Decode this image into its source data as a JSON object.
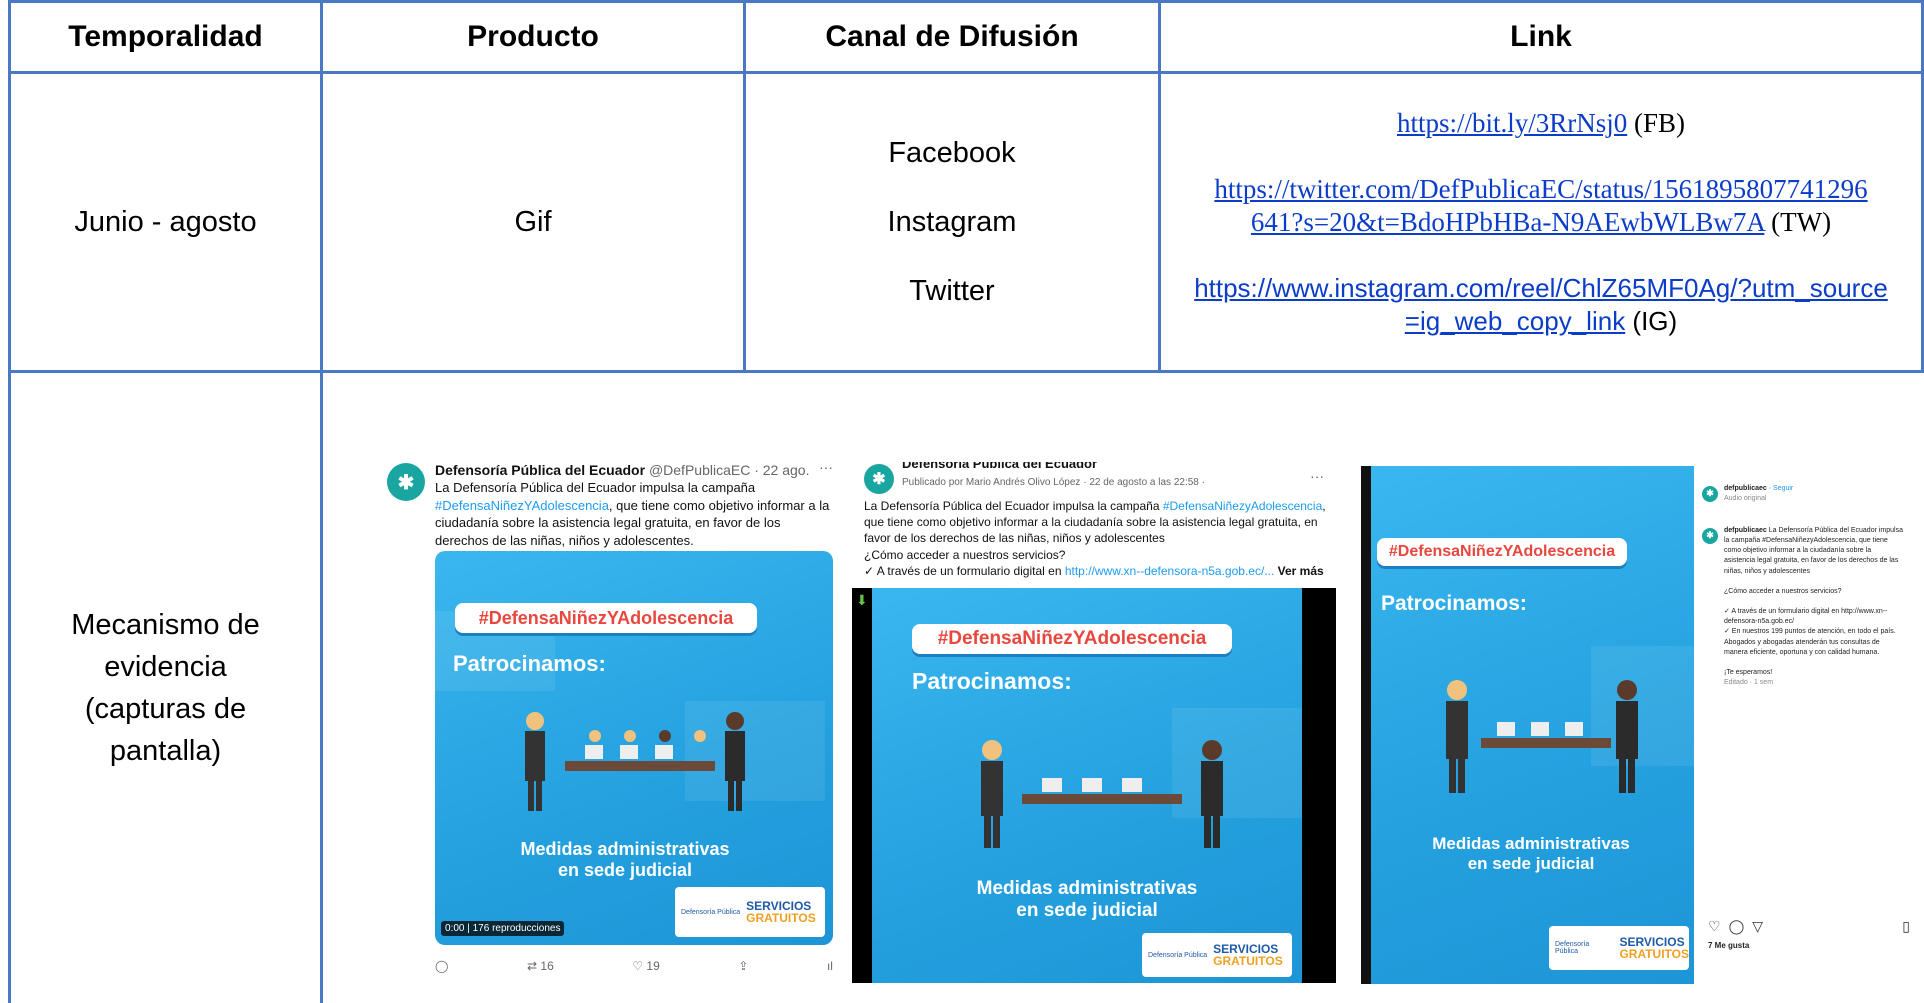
{
  "table": {
    "headers": {
      "temporalidad": "Temporalidad",
      "producto": "Producto",
      "canal": "Canal de Difusión",
      "link": "Link"
    },
    "row1": {
      "temporalidad": "Junio - agosto",
      "producto": "Gif",
      "canales": [
        "Facebook",
        "Instagram",
        "Twitter"
      ],
      "links": [
        {
          "url": "https://bit.ly/3RrNsj0",
          "tag": " (FB)"
        },
        {
          "url_line1": "https://twitter.com/DefPublicaEC/status/1561895807741296",
          "url_line2": "641?s=20&t=BdoHPbHBa-N9AEwbWLBw7A",
          "tag": " (TW)"
        },
        {
          "url_line1": "https://www.instagram.com/reel/ChlZ65MF0Ag/?utm_source",
          "url_line2": "=ig_web_copy_link",
          "tag": " (IG)"
        }
      ]
    },
    "row2": {
      "label_lines": [
        "Mecanismo de",
        "evidencia",
        "(capturas de",
        "pantalla)"
      ]
    }
  },
  "shots": {
    "twitter": {
      "name": "Defensoría Pública del Ecuador",
      "handle": "@DefPublicaEC · 22 ago.",
      "text_1": "La Defensoría Pública del Ecuador impulsa la campaña",
      "hashtag_link": "#DefensaNiñezYAdolescencia",
      "text_2": ", que tiene como objetivo informar a la ciudadanía sobre la asistencia legal gratuita, en favor de los derechos de las niñas, niños y adolescentes.",
      "video_time": "0:00",
      "views": "176 reproducciones",
      "retweets": "16",
      "likes": "19"
    },
    "facebook": {
      "name": "Defensoría Pública del Ecuador",
      "published": "Publicado por Mario Andrés Olivo López · 22 de agosto a las 22:58 · ",
      "text_1": "La Defensoría Pública del Ecuador impulsa la campaña ",
      "hashtag_link": "#DefensaNiñezyAdolescencia",
      "text_2": ", que tiene como objetivo informar a la ciudadanía sobre la asistencia legal gratuita, en favor de los derechos de las niñas, niños y adolescentes",
      "question": "¿Cómo acceder a nuestros servicios?",
      "via": "✓ A través de un formulario digital en ",
      "via_link": "http://www.xn--defensora-n5a.gob.ec/...",
      "more": " Ver más"
    },
    "instagram": {
      "user": "defpublicaec",
      "follow": "Seguir",
      "audio": "Audio original",
      "caption_user": "defpublicaec",
      "caption": "La Defensoría Pública del Ecuador impulsa la campaña #DefensaNiñezyAdolescencia, que tiene como objetivo informar a la ciudadanía sobre la asistencia legal gratuita, en favor de los derechos de las niñas, niños y adolescentes",
      "question": "¿Cómo acceder a nuestros servicios?",
      "line_a": "✓ A través de un formulario digital en http://www.xn--defensora-n5a.gob.ec/",
      "line_b": "✓ En nuestros 199 puntos de atención, en todo el país. Abogados y abogadas atenderán tus consultas de manera eficiente, oportuna y con calidad humana.",
      "closing": "¡Te esperamos!",
      "edited": "Editado · 1 sem",
      "likes": "7 Me gusta"
    },
    "poster": {
      "hashtag": "#DefensaNiñezYAdolescencia",
      "patro": "Patrocinamos:",
      "medidas_1": "Medidas administrativas",
      "medidas_2": "en sede judicial",
      "servicios_1": "SERVICIOS",
      "servicios_2": "GRATUITOS",
      "logo_text": "Defensoría Pública"
    }
  },
  "colors": {
    "border": "#4a78c2",
    "link": "#0b3dc9",
    "poster_blue": "#25a2e0",
    "hashtag_red": "#e8473e"
  }
}
